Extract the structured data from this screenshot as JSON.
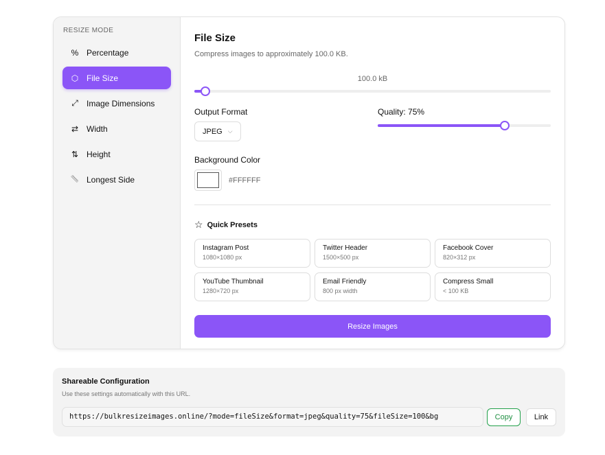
{
  "sidebar": {
    "heading": "RESIZE MODE",
    "items": [
      {
        "label": "Percentage",
        "icon": "%"
      },
      {
        "label": "File Size",
        "icon": "⬡"
      },
      {
        "label": "Image Dimensions",
        "icon": "⤢"
      },
      {
        "label": "Width",
        "icon": "⇄"
      },
      {
        "label": "Height",
        "icon": "⇅"
      },
      {
        "label": "Longest Side",
        "icon": "📏"
      }
    ],
    "active": "File Size"
  },
  "main": {
    "title": "File Size",
    "subtitle": "Compress images to approximately 100.0 KB.",
    "file_size_value": "100.0 kB",
    "file_size_fraction": 0.03,
    "output_format_label": "Output Format",
    "output_format": "JPEG",
    "quality_label": "Quality: 75%",
    "quality": 75,
    "bg_label": "Background Color",
    "bg_hex": "#FFFFFF",
    "presets_title": "Quick Presets",
    "presets": [
      {
        "name": "Instagram Post",
        "desc": "1080×1080 px"
      },
      {
        "name": "Twitter Header",
        "desc": "1500×500 px"
      },
      {
        "name": "Facebook Cover",
        "desc": "820×312 px"
      },
      {
        "name": "YouTube Thumbnail",
        "desc": "1280×720 px"
      },
      {
        "name": "Email Friendly",
        "desc": "800 px width"
      },
      {
        "name": "Compress Small",
        "desc": "< 100 KB"
      }
    ],
    "resize_button": "Resize Images"
  },
  "share": {
    "title": "Shareable Configuration",
    "subtitle": "Use these settings automatically with this URL.",
    "url": "https://bulkresizeimages.online/?mode=fileSize&format=jpeg&quality=75&fileSize=100&bg",
    "copy": "Copy",
    "link": "Link"
  },
  "colors": {
    "accent": "#8b55f7",
    "copy_green": "#22a04a"
  }
}
